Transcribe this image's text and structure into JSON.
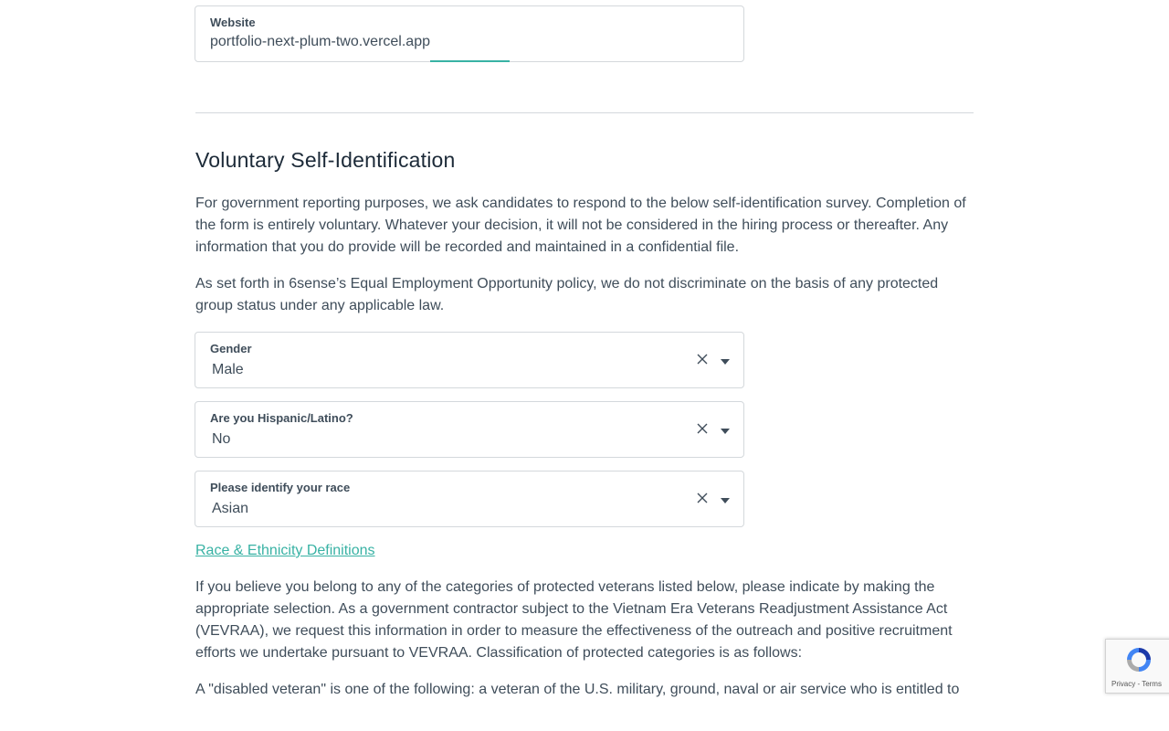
{
  "website": {
    "label": "Website",
    "value": "portfolio-next-plum-two.vercel.app"
  },
  "section": {
    "title": "Voluntary Self-Identification",
    "intro": "For government reporting purposes, we ask candidates to respond to the below self-identification survey. Completion of the form is entirely voluntary. Whatever your decision, it will not be considered in the hiring process or thereafter. Any information that you do provide will be recorded and maintained in a confidential file.",
    "policy": "As set forth in 6sense’s Equal Employment Opportunity policy, we do not discriminate on the basis of any protected group status under any applicable law."
  },
  "gender": {
    "label": "Gender",
    "value": "Male"
  },
  "hispanic": {
    "label": "Are you Hispanic/Latino?",
    "value": "No"
  },
  "race": {
    "label": "Please identify your race",
    "value": "Asian"
  },
  "race_link": "Race & Ethnicity Definitions",
  "veterans": {
    "intro": "If you believe you belong to any of the categories of protected veterans listed below, please indicate by making the appropriate selection. As a government contractor subject to the Vietnam Era Veterans Readjustment Assistance Act (VEVRAA), we request this information in order to measure the effectiveness of the outreach and positive recruitment efforts we undertake pursuant to VEVRAA. Classification of protected categories is as follows:",
    "disabled_def": "A \"disabled veteran\" is one of the following: a veteran of the U.S. military, ground, naval or air service who is entitled to"
  },
  "recaptcha": {
    "text": "Privacy - Terms"
  },
  "colors": {
    "accent": "#38b2a4",
    "text": "#3f4d5a",
    "border": "#d4d8dc"
  },
  "icons": {
    "clear": "close-icon",
    "caret": "caret-down-icon"
  }
}
